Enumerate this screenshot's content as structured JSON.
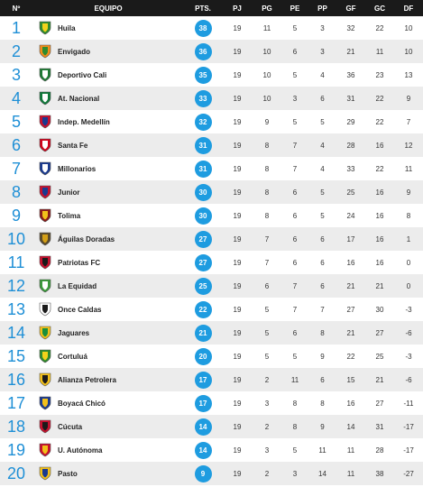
{
  "header": {
    "pos": "Nº",
    "team": "EQUIPO",
    "pts": "PTS.",
    "pj": "PJ",
    "pg": "PG",
    "pe": "PE",
    "pp": "PP",
    "gf": "GF",
    "gc": "GC",
    "df": "DF"
  },
  "rows": [
    {
      "pos": "1",
      "team": "Huila",
      "pts": "38",
      "pj": "19",
      "pg": "11",
      "pe": "5",
      "pp": "3",
      "gf": "32",
      "gc": "22",
      "df": "10",
      "logo_colors": [
        "#2e8b2e",
        "#f2d21b"
      ],
      "logo_icon": "huila-crest-icon"
    },
    {
      "pos": "2",
      "team": "Envigado",
      "pts": "36",
      "pj": "19",
      "pg": "10",
      "pe": "6",
      "pp": "3",
      "gf": "21",
      "gc": "11",
      "df": "10",
      "logo_colors": [
        "#f28c1b",
        "#2e8b2e"
      ],
      "logo_icon": "envigado-crest-icon"
    },
    {
      "pos": "3",
      "team": "Deportivo Cali",
      "pts": "35",
      "pj": "19",
      "pg": "10",
      "pe": "5",
      "pp": "4",
      "gf": "36",
      "gc": "23",
      "df": "13",
      "logo_colors": [
        "#1e7a34",
        "#ffffff"
      ],
      "logo_icon": "cali-crest-icon"
    },
    {
      "pos": "4",
      "team": "At. Nacional",
      "pts": "33",
      "pj": "19",
      "pg": "10",
      "pe": "3",
      "pp": "6",
      "gf": "31",
      "gc": "22",
      "df": "9",
      "logo_colors": [
        "#0f7a3a",
        "#ffffff"
      ],
      "logo_icon": "nacional-crest-icon"
    },
    {
      "pos": "5",
      "team": "Indep. Medellín",
      "pts": "32",
      "pj": "19",
      "pg": "9",
      "pe": "5",
      "pp": "5",
      "gf": "29",
      "gc": "22",
      "df": "7",
      "logo_colors": [
        "#c8102e",
        "#1a3a8f"
      ],
      "logo_icon": "medellin-crest-icon"
    },
    {
      "pos": "6",
      "team": "Santa Fe",
      "pts": "31",
      "pj": "19",
      "pg": "8",
      "pe": "7",
      "pp": "4",
      "gf": "28",
      "gc": "16",
      "df": "12",
      "logo_colors": [
        "#d0021b",
        "#ffffff"
      ],
      "logo_icon": "santafe-crest-icon"
    },
    {
      "pos": "7",
      "team": "Millonarios",
      "pts": "31",
      "pj": "19",
      "pg": "8",
      "pe": "7",
      "pp": "4",
      "gf": "33",
      "gc": "22",
      "df": "11",
      "logo_colors": [
        "#1a3a8f",
        "#ffffff"
      ],
      "logo_icon": "millonarios-crest-icon"
    },
    {
      "pos": "8",
      "team": "Junior",
      "pts": "30",
      "pj": "19",
      "pg": "8",
      "pe": "6",
      "pp": "5",
      "gf": "25",
      "gc": "16",
      "df": "9",
      "logo_colors": [
        "#c8102e",
        "#1a3a8f"
      ],
      "logo_icon": "junior-crest-icon"
    },
    {
      "pos": "9",
      "team": "Tolima",
      "pts": "30",
      "pj": "19",
      "pg": "8",
      "pe": "6",
      "pp": "5",
      "gf": "24",
      "gc": "16",
      "df": "8",
      "logo_colors": [
        "#8b1a1a",
        "#f2c01b"
      ],
      "logo_icon": "tolima-crest-icon"
    },
    {
      "pos": "10",
      "team": "Águilas Doradas",
      "pts": "27",
      "pj": "19",
      "pg": "7",
      "pe": "6",
      "pp": "6",
      "gf": "17",
      "gc": "16",
      "df": "1",
      "logo_colors": [
        "#5a4a2a",
        "#d4a017"
      ],
      "logo_icon": "aguilas-crest-icon"
    },
    {
      "pos": "11",
      "team": "Patriotas FC",
      "pts": "27",
      "pj": "19",
      "pg": "7",
      "pe": "6",
      "pp": "6",
      "gf": "16",
      "gc": "16",
      "df": "0",
      "logo_colors": [
        "#c8102e",
        "#1a1a1a"
      ],
      "logo_icon": "patriotas-crest-icon"
    },
    {
      "pos": "12",
      "team": "La Equidad",
      "pts": "25",
      "pj": "19",
      "pg": "6",
      "pe": "7",
      "pp": "6",
      "gf": "21",
      "gc": "21",
      "df": "0",
      "logo_colors": [
        "#3a9a3a",
        "#ffffff"
      ],
      "logo_icon": "equidad-crest-icon"
    },
    {
      "pos": "13",
      "team": "Once Caldas",
      "pts": "22",
      "pj": "19",
      "pg": "5",
      "pe": "7",
      "pp": "7",
      "gf": "27",
      "gc": "30",
      "df": "-3",
      "logo_colors": [
        "#ffffff",
        "#1a1a1a"
      ],
      "logo_icon": "oncecaldas-crest-icon"
    },
    {
      "pos": "14",
      "team": "Jaguares",
      "pts": "21",
      "pj": "19",
      "pg": "5",
      "pe": "6",
      "pp": "8",
      "gf": "21",
      "gc": "27",
      "df": "-6",
      "logo_colors": [
        "#f2c01b",
        "#1a8f3a"
      ],
      "logo_icon": "jaguares-crest-icon"
    },
    {
      "pos": "15",
      "team": "Cortuluá",
      "pts": "20",
      "pj": "19",
      "pg": "5",
      "pe": "5",
      "pp": "9",
      "gf": "22",
      "gc": "25",
      "df": "-3",
      "logo_colors": [
        "#2e8b2e",
        "#f2d21b"
      ],
      "logo_icon": "cortulua-crest-icon"
    },
    {
      "pos": "16",
      "team": "Alianza Petrolera",
      "pts": "17",
      "pj": "19",
      "pg": "2",
      "pe": "11",
      "pp": "6",
      "gf": "15",
      "gc": "21",
      "df": "-6",
      "logo_colors": [
        "#f2c01b",
        "#1a1a1a"
      ],
      "logo_icon": "alianza-crest-icon"
    },
    {
      "pos": "17",
      "team": "Boyacá Chicó",
      "pts": "17",
      "pj": "19",
      "pg": "3",
      "pe": "8",
      "pp": "8",
      "gf": "16",
      "gc": "27",
      "df": "-11",
      "logo_colors": [
        "#1a3a8f",
        "#f2c01b"
      ],
      "logo_icon": "chico-crest-icon"
    },
    {
      "pos": "18",
      "team": "Cúcuta",
      "pts": "14",
      "pj": "19",
      "pg": "2",
      "pe": "8",
      "pp": "9",
      "gf": "14",
      "gc": "31",
      "df": "-17",
      "logo_colors": [
        "#c8102e",
        "#1a1a1a"
      ],
      "logo_icon": "cucuta-crest-icon"
    },
    {
      "pos": "19",
      "team": "U. Autónoma",
      "pts": "14",
      "pj": "19",
      "pg": "3",
      "pe": "5",
      "pp": "11",
      "gf": "11",
      "gc": "28",
      "df": "-17",
      "logo_colors": [
        "#c8102e",
        "#f2c01b"
      ],
      "logo_icon": "autonoma-crest-icon"
    },
    {
      "pos": "20",
      "team": "Pasto",
      "pts": "9",
      "pj": "19",
      "pg": "2",
      "pe": "3",
      "pp": "14",
      "gf": "11",
      "gc": "38",
      "df": "-27",
      "logo_colors": [
        "#f2c01b",
        "#1a3a8f"
      ],
      "logo_icon": "pasto-crest-icon"
    }
  ],
  "colors": {
    "accent": "#1e8fd6",
    "badge": "#1e9ce0",
    "header_bg": "#1a1a1a",
    "row_alt": "#ececec"
  }
}
